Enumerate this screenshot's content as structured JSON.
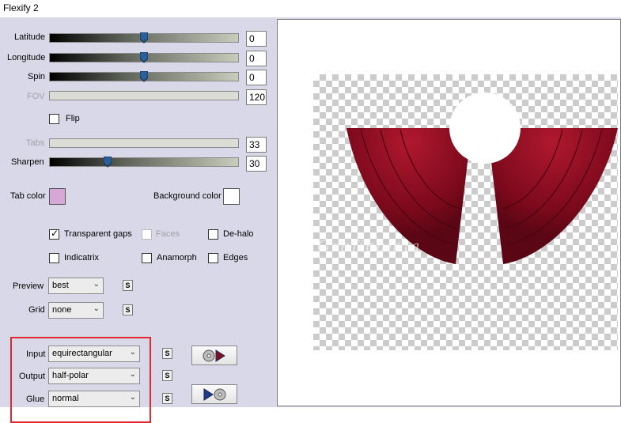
{
  "window": {
    "title": "Flexify 2"
  },
  "sliders": [
    {
      "label": "Latitude",
      "value": "0",
      "enabled": true
    },
    {
      "label": "Longitude",
      "value": "0",
      "enabled": true
    },
    {
      "label": "Spin",
      "value": "0",
      "enabled": true
    },
    {
      "label": "FOV",
      "value": "120",
      "enabled": false
    },
    {
      "label": "Tabs",
      "value": "33",
      "enabled": false
    },
    {
      "label": "Sharpen",
      "value": "30",
      "enabled": true
    }
  ],
  "flip": {
    "label": "Flip",
    "checked": false
  },
  "colors": {
    "tab_color_label": "Tab color",
    "tab_color": "#d6a8d6",
    "background_color_label": "Background color",
    "background_color": "#ffffff",
    "shape_color": "#8a0a1e"
  },
  "options": {
    "transparent_gaps": {
      "label": "Transparent gaps",
      "checked": true
    },
    "faces": {
      "label": "Faces",
      "checked": false,
      "enabled": false
    },
    "de_halo": {
      "label": "De-halo",
      "checked": false
    },
    "indicatrix": {
      "label": "Indicatrix",
      "checked": false
    },
    "anamorph": {
      "label": "Anamorph",
      "checked": false
    },
    "edges": {
      "label": "Edges",
      "checked": false
    }
  },
  "dropdowns": {
    "preview": {
      "label": "Preview",
      "value": "best"
    },
    "grid": {
      "label": "Grid",
      "value": "none"
    },
    "input": {
      "label": "Input",
      "value": "equirectangular"
    },
    "output": {
      "label": "Output",
      "value": "half-polar"
    },
    "glue": {
      "label": "Glue",
      "value": "normal"
    }
  },
  "s_button_label": "S",
  "preview_watermark": "Graficamia"
}
